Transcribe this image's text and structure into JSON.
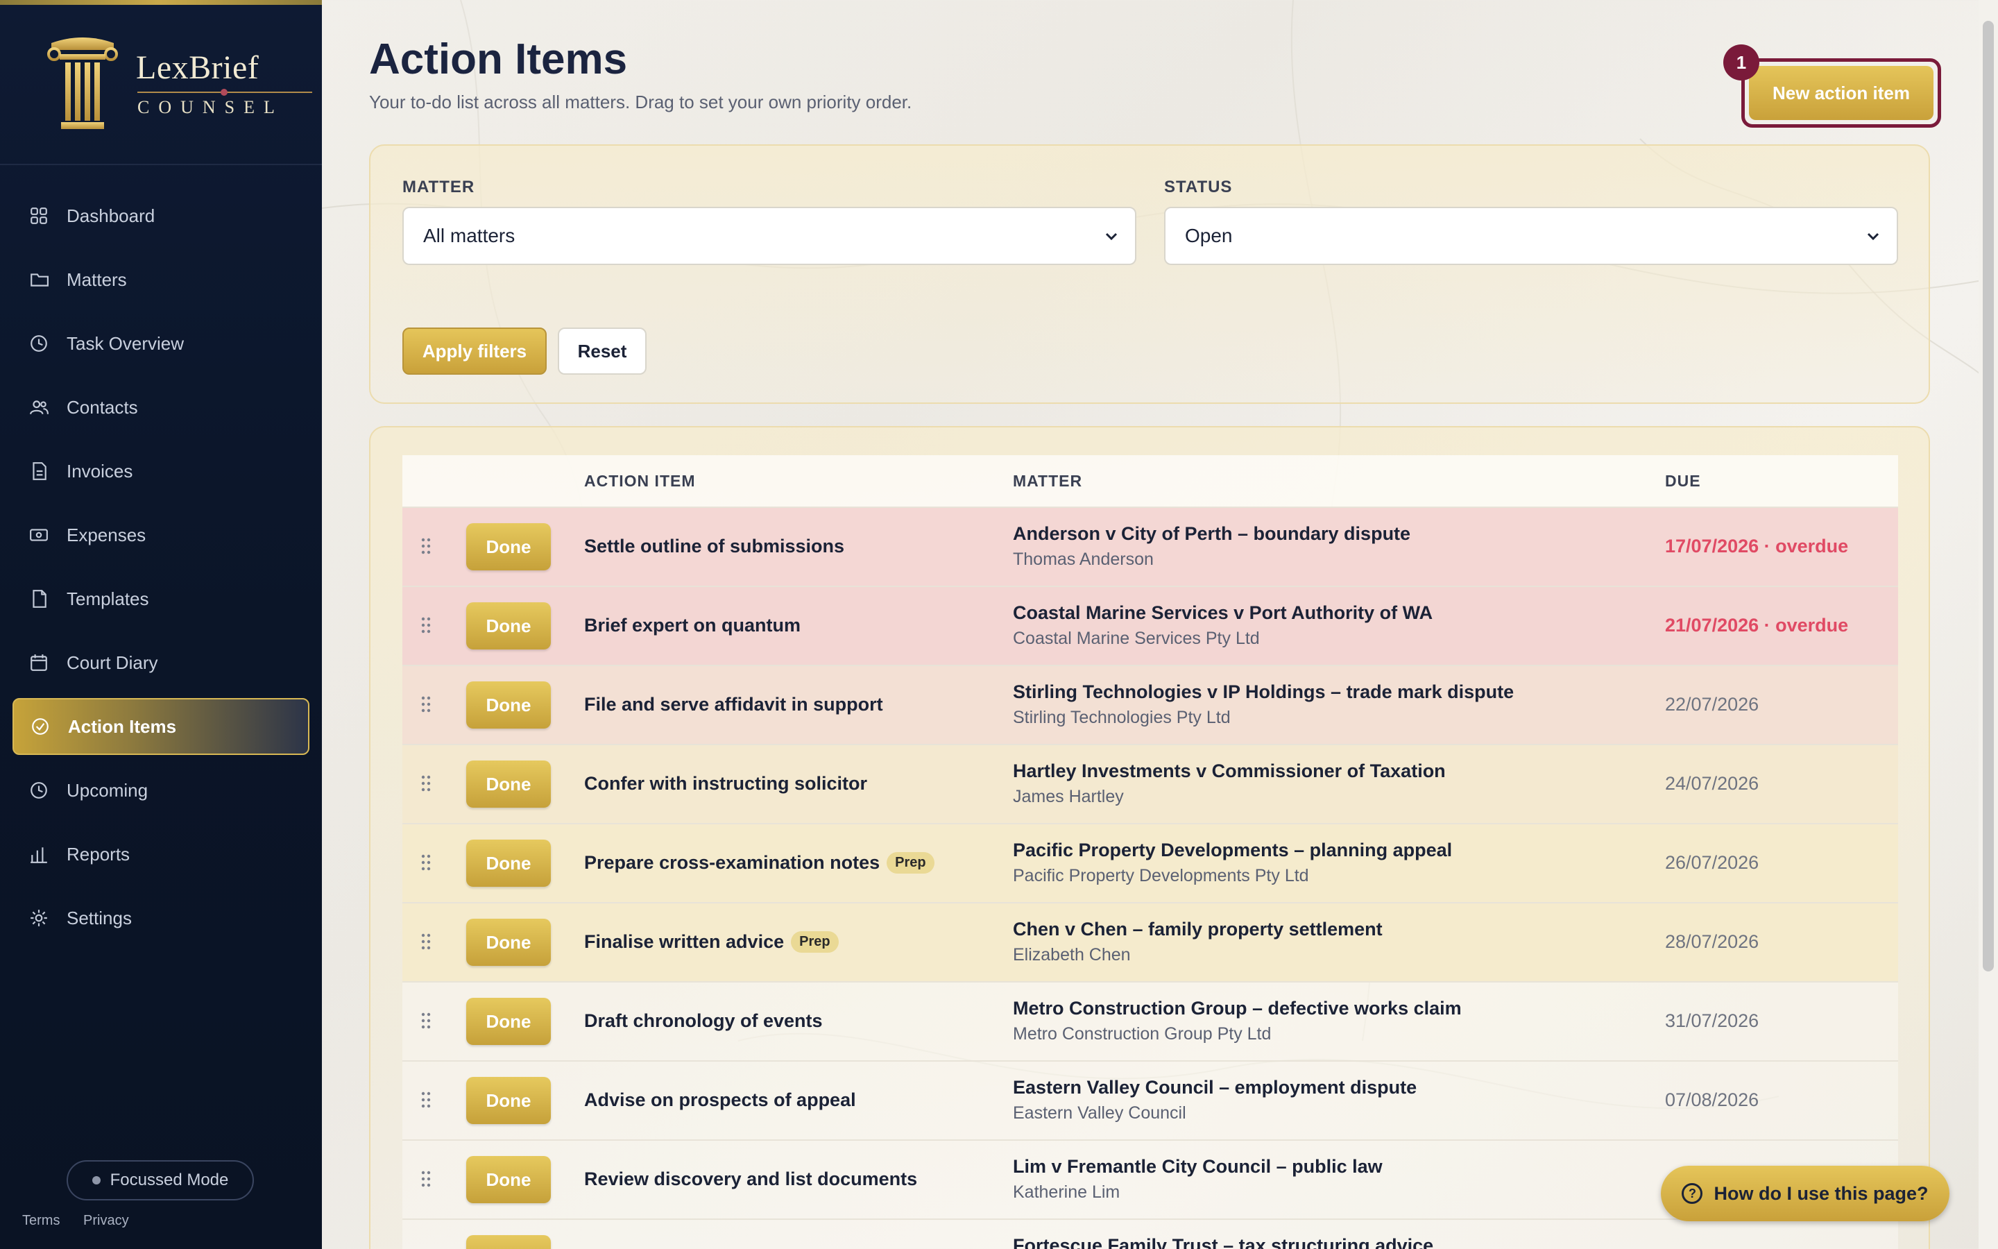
{
  "brand": {
    "name": "LexBrief",
    "sub": "COUNSEL"
  },
  "nav": [
    {
      "label": "Dashboard",
      "icon": "grid-icon",
      "active": false
    },
    {
      "label": "Matters",
      "icon": "folder-icon",
      "active": false
    },
    {
      "label": "Task Overview",
      "icon": "clock-icon",
      "active": false
    },
    {
      "label": "Contacts",
      "icon": "users-icon",
      "active": false
    },
    {
      "label": "Invoices",
      "icon": "invoice-icon",
      "active": false
    },
    {
      "label": "Expenses",
      "icon": "cash-icon",
      "active": false
    },
    {
      "label": "Templates",
      "icon": "document-icon",
      "active": false
    },
    {
      "label": "Court Diary",
      "icon": "calendar-icon",
      "active": false
    },
    {
      "label": "Action Items",
      "icon": "check-circle-icon",
      "active": true
    },
    {
      "label": "Upcoming",
      "icon": "clock-icon",
      "active": false
    },
    {
      "label": "Reports",
      "icon": "bar-chart-icon",
      "active": false
    },
    {
      "label": "Settings",
      "icon": "gear-icon",
      "active": false
    }
  ],
  "focus_mode": "Focussed Mode",
  "footer": {
    "terms": "Terms",
    "privacy": "Privacy"
  },
  "page": {
    "title": "Action Items",
    "subtitle": "Your to-do list across all matters. Drag to set your own priority order.",
    "new_button": "New action item",
    "badge": "1"
  },
  "filters": {
    "matter_label": "MATTER",
    "matter_value": "All matters",
    "status_label": "STATUS",
    "status_value": "Open",
    "apply": "Apply filters",
    "reset": "Reset"
  },
  "table": {
    "headers": {
      "item": "ACTION ITEM",
      "matter": "MATTER",
      "due": "DUE"
    },
    "done_label": "Done",
    "rows": [
      {
        "title": "Settle outline of submissions",
        "tag": "",
        "matter": "Anderson v City of Perth – boundary dispute",
        "client": "Thomas Anderson",
        "due": "17/07/2026 · overdue",
        "overdue": true,
        "tint": "#f4d7d4"
      },
      {
        "title": "Brief expert on quantum",
        "tag": "",
        "matter": "Coastal Marine Services v Port Authority of WA",
        "client": "Coastal Marine Services Pty Ltd",
        "due": "21/07/2026 · overdue",
        "overdue": true,
        "tint": "#f3d6d3"
      },
      {
        "title": "File and serve affidavit in support",
        "tag": "",
        "matter": "Stirling Technologies v IP Holdings – trade mark dispute",
        "client": "Stirling Technologies Pty Ltd",
        "due": "22/07/2026",
        "overdue": false,
        "tint": "#f3e0d4"
      },
      {
        "title": "Confer with instructing solicitor",
        "tag": "",
        "matter": "Hartley Investments v Commissioner of Taxation",
        "client": "James Hartley",
        "due": "24/07/2026",
        "overdue": false,
        "tint": "#f4e9d0"
      },
      {
        "title": "Prepare cross-examination notes",
        "tag": "Prep",
        "matter": "Pacific Property Developments – planning appeal",
        "client": "Pacific Property Developments Pty Ltd",
        "due": "26/07/2026",
        "overdue": false,
        "tint": "#f5ebcd"
      },
      {
        "title": "Finalise written advice",
        "tag": "Prep",
        "matter": "Chen v Chen – family property settlement",
        "client": "Elizabeth Chen",
        "due": "28/07/2026",
        "overdue": false,
        "tint": "#f5ebcd"
      },
      {
        "title": "Draft chronology of events",
        "tag": "",
        "matter": "Metro Construction Group – defective works claim",
        "client": "Metro Construction Group Pty Ltd",
        "due": "31/07/2026",
        "overdue": false,
        "tint": "rgba(255,255,255,0.35)"
      },
      {
        "title": "Advise on prospects of appeal",
        "tag": "",
        "matter": "Eastern Valley Council – employment dispute",
        "client": "Eastern Valley Council",
        "due": "07/08/2026",
        "overdue": false,
        "tint": "rgba(255,255,255,0.35)"
      },
      {
        "title": "Review discovery and list documents",
        "tag": "",
        "matter": "Lim v Fremantle City Council – public law",
        "client": "Katherine Lim",
        "due": "",
        "overdue": false,
        "tint": "rgba(255,255,255,0.35)"
      },
      {
        "title": "",
        "tag": "",
        "matter": "Fortescue Family Trust – tax structuring advice",
        "client": "",
        "due": "",
        "overdue": false,
        "tint": "rgba(255,255,255,0.35)"
      }
    ]
  },
  "help_button": "How do I use this page?",
  "colors": {
    "accent_gold": "#c9a13a",
    "navy": "#0e1a33",
    "overdue": "#e04a64",
    "badge": "#7a1a3a"
  }
}
